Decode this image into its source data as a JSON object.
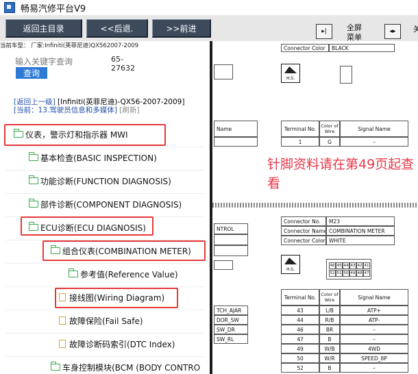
{
  "window": {
    "title": "畅易汽修平台V9"
  },
  "toolbar": {
    "home": "返回主目录",
    "back": "<<后退.",
    "forward": ">>前进",
    "fullscreen_line1": "全屏",
    "fullscreen_line2": "菜单",
    "cut_label": "关"
  },
  "vehicle_line": "当前车型： 厂家:Infiniti(英菲尼迪)QX562007-2009",
  "search": {
    "placeholder": "输入关键字查询",
    "button": "查询",
    "code_line1": "65-",
    "code_line2": "27632"
  },
  "breadcrumb": {
    "up": "[返回上一级]",
    "model": "[Infiniti(英菲尼迪)-QX56-2007-2009]",
    "current": "[当前：13.驾驶员信息和多媒体]",
    "refresh": "[刷新]"
  },
  "tree": [
    {
      "label": "仪表，警示灯和指示器 MWI",
      "type": "folder"
    },
    {
      "label": "基本检查(BASIC INSPECTION)",
      "type": "folder"
    },
    {
      "label": "功能诊断(FUNCTION DIAGNOSIS)",
      "type": "folder"
    },
    {
      "label": "部件诊断(COMPONENT DIAGNOSIS)",
      "type": "folder"
    },
    {
      "label": "ECU诊断(ECU DIAGNOSIS)",
      "type": "folder"
    },
    {
      "label": "组合仪表(COMBINATION METER)",
      "type": "folder"
    },
    {
      "label": "参考值(Reference Value)",
      "type": "folder"
    },
    {
      "label": "接线图(Wiring Diagram)",
      "type": "doc"
    },
    {
      "label": "故障保险(Fail Safe)",
      "type": "doc"
    },
    {
      "label": "故障诊断码索引(DTC Index)",
      "type": "doc"
    },
    {
      "label": "车身控制模块(BCM (BODY CONTRO",
      "type": "folder"
    }
  ],
  "diagram": {
    "top_connector_color_label": "Connector Color",
    "top_connector_color": "BLACK",
    "hs": "H.S.",
    "table1": {
      "terminal": "Terminal No.",
      "color": "Color of Wire",
      "signal": "Signal Name",
      "name_col": "Name",
      "row_terminal": "1",
      "row_color": "G",
      "row_signal": "–"
    },
    "annotation": "针脚资料请在第49页起查看",
    "connector": {
      "no_label": "Connector No.",
      "no": "M23",
      "name_label": "Connector Name",
      "name": "COMBINATION METER",
      "color_label": "Connector Color",
      "color": "WHITE"
    },
    "partial_left": [
      "NTROL",
      "TCH_AJAR",
      "DOR_SW",
      "SW_DR",
      "SW_RL"
    ],
    "pins_top": [
      "46",
      "45",
      "44",
      "43",
      "42",
      "41"
    ],
    "pins_bottom": [
      "52",
      "51",
      "50",
      "49",
      "48",
      "47"
    ],
    "pin_table_header": {
      "terminal": "Terminal No.",
      "color": "Color of Wire",
      "signal": "Signal Name"
    },
    "pins": [
      {
        "t": "43",
        "c": "L/B",
        "s": "ATP+"
      },
      {
        "t": "44",
        "c": "R/B",
        "s": "ATP-"
      },
      {
        "t": "46",
        "c": "BR",
        "s": "–"
      },
      {
        "t": "47",
        "c": "B",
        "s": "–"
      },
      {
        "t": "49",
        "c": "W/B",
        "s": "4WD"
      },
      {
        "t": "50",
        "c": "W/R",
        "s": "SPEED_8P"
      },
      {
        "t": "52",
        "c": "B",
        "s": "–"
      }
    ]
  }
}
